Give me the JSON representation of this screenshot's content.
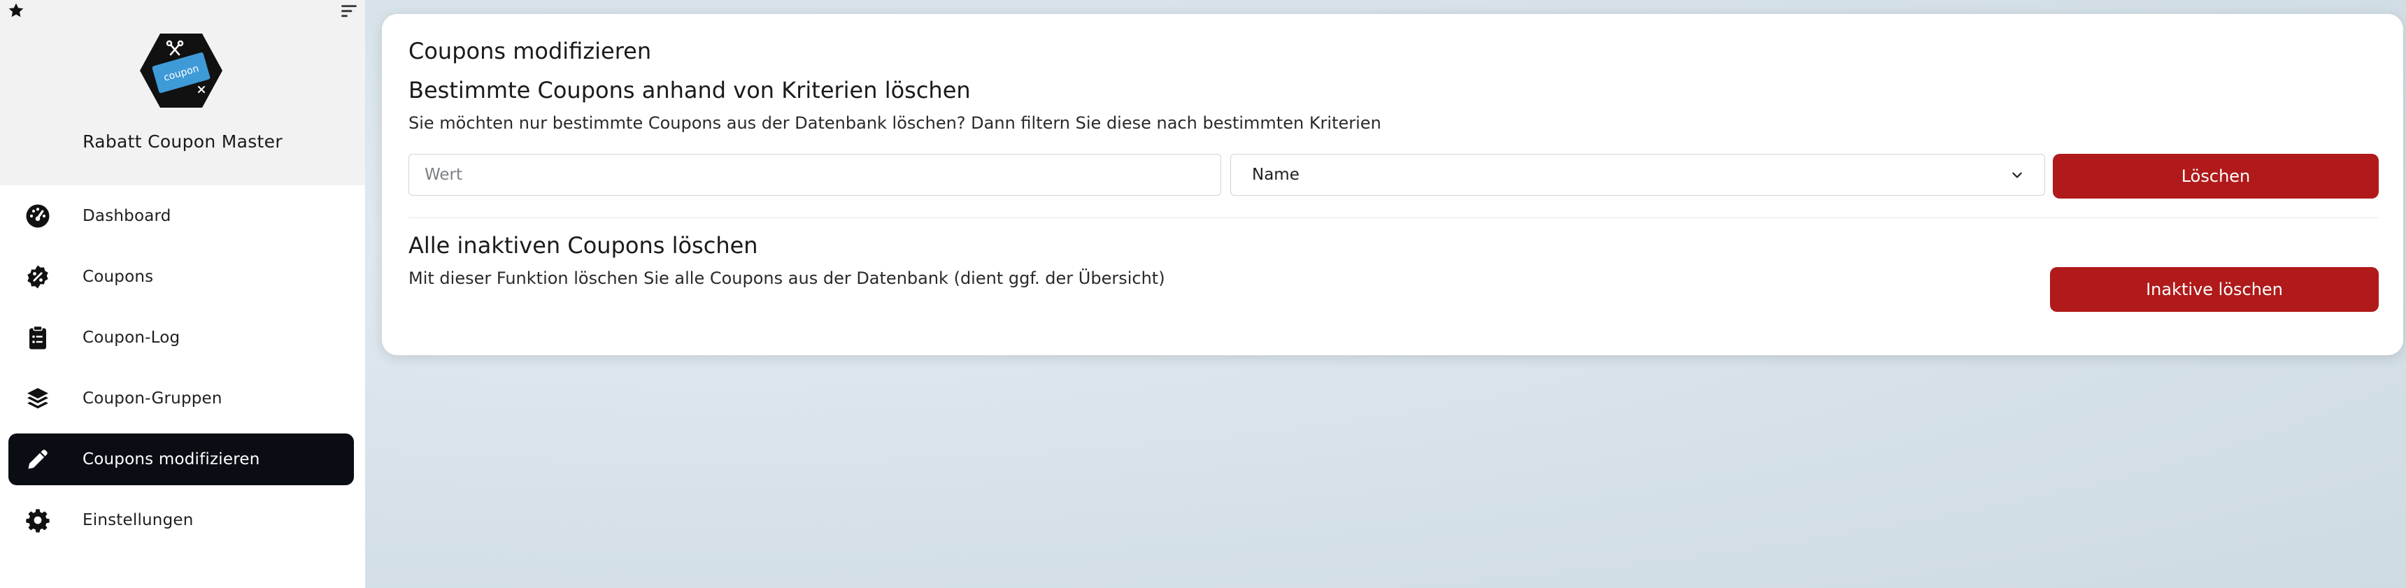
{
  "sidebar": {
    "brand": "Rabatt Coupon Master",
    "logo_text": "coupon",
    "items": [
      {
        "label": "Dashboard",
        "icon": "gauge-icon",
        "active": false
      },
      {
        "label": "Coupons",
        "icon": "percent-badge-icon",
        "active": false
      },
      {
        "label": "Coupon-Log",
        "icon": "clipboard-list-icon",
        "active": false
      },
      {
        "label": "Coupon-Gruppen",
        "icon": "layers-icon",
        "active": false
      },
      {
        "label": "Coupons modifizieren",
        "icon": "pencil-icon",
        "active": true
      },
      {
        "label": "Einstellungen",
        "icon": "gear-icon",
        "active": false
      }
    ]
  },
  "main": {
    "title": "Coupons modifizieren",
    "filter_section": {
      "title": "Bestimmte Coupons anhand von Kriterien löschen",
      "description": "Sie möchten nur bestimmte Coupons aus der Datenbank löschen? Dann filtern Sie diese nach bestimmten Kriterien",
      "value_input": {
        "placeholder": "Wert",
        "value": ""
      },
      "criteria_select": {
        "selected": "Name"
      },
      "delete_button": "Löschen"
    },
    "inactive_section": {
      "title": "Alle inaktiven Coupons löschen",
      "description": "Mit dieser Funktion löschen Sie alle Coupons aus der Datenbank (dient ggf. der Übersicht)",
      "button": "Inaktive löschen"
    }
  },
  "colors": {
    "accent": "#b01a1a",
    "active_nav": "#0a0d14",
    "logo_blue": "#3f9ad8",
    "logo_hex": "#111111"
  }
}
